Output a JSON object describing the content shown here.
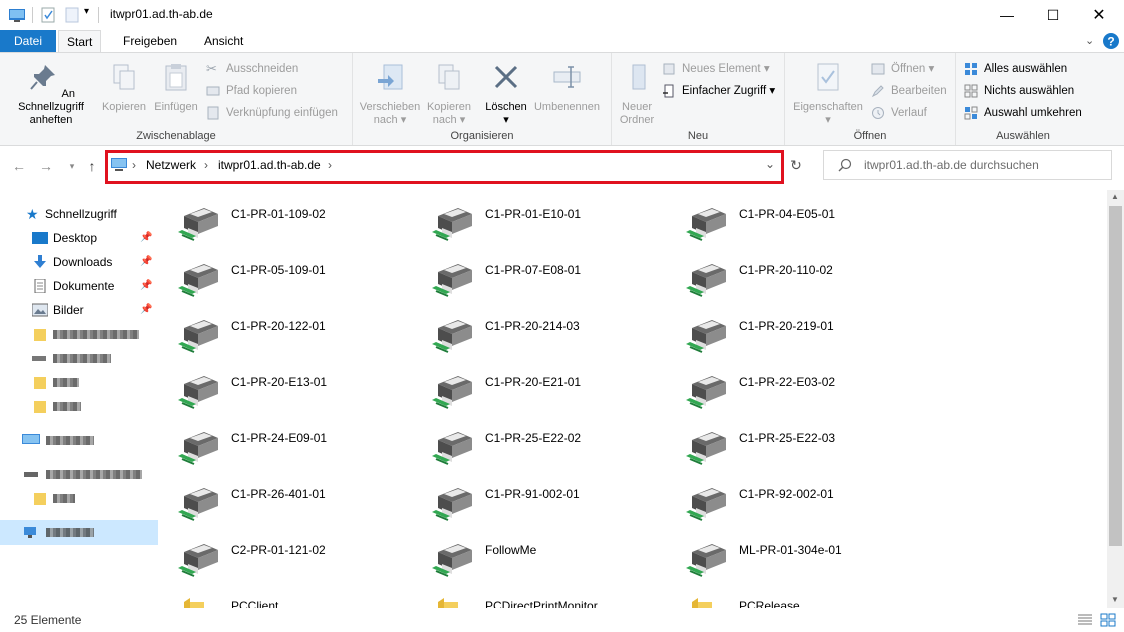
{
  "window": {
    "title": "itwpr01.ad.th-ab.de"
  },
  "ribbon_tabs": [
    "Datei",
    "Start",
    "Freigeben",
    "Ansicht"
  ],
  "ribbon": {
    "clipboard": {
      "pin_quick_access": "An Schnellzugriff anheften",
      "copy": "Kopieren",
      "paste": "Einfügen",
      "cut": "Ausschneiden",
      "copy_path": "Pfad kopieren",
      "paste_shortcut": "Verknüpfung einfügen",
      "group_label": "Zwischenablage"
    },
    "organize": {
      "move_to": "Verschieben nach",
      "copy_to": "Kopieren nach",
      "delete": "Löschen",
      "rename": "Umbenennen",
      "group_label": "Organisieren"
    },
    "new": {
      "new_folder": "Neuer Ordner",
      "new_item": "Neues Element",
      "easy_access": "Einfacher Zugriff",
      "group_label": "Neu"
    },
    "open": {
      "properties": "Eigenschaften",
      "open": "Öffnen",
      "edit": "Bearbeiten",
      "history": "Verlauf",
      "group_label": "Öffnen"
    },
    "select": {
      "select_all": "Alles auswählen",
      "select_none": "Nichts auswählen",
      "invert": "Auswahl umkehren",
      "group_label": "Auswählen"
    }
  },
  "address_bar": {
    "crumbs": [
      "Netzwerk",
      "itwpr01.ad.th-ab.de"
    ]
  },
  "search": {
    "placeholder": "itwpr01.ad.th-ab.de durchsuchen"
  },
  "sidebar": {
    "quick_access": "Schnellzugriff",
    "items": [
      "Desktop",
      "Downloads",
      "Dokumente",
      "Bilder"
    ]
  },
  "files": {
    "printers": [
      "C1-PR-01-109-02",
      "C1-PR-01-E10-01",
      "C1-PR-04-E05-01",
      "C1-PR-05-109-01",
      "C1-PR-07-E08-01",
      "C1-PR-20-110-02",
      "C1-PR-20-122-01",
      "C1-PR-20-214-03",
      "C1-PR-20-219-01",
      "C1-PR-20-E13-01",
      "C1-PR-20-E21-01",
      "C1-PR-22-E03-02",
      "C1-PR-24-E09-01",
      "C1-PR-25-E22-02",
      "C1-PR-25-E22-03",
      "C1-PR-26-401-01",
      "C1-PR-91-002-01",
      "C1-PR-92-002-01",
      "C2-PR-01-121-02",
      "FollowMe",
      "ML-PR-01-304e-01"
    ],
    "folders": [
      "PCClient",
      "PCDirectPrintMonitor",
      "PCRelease"
    ]
  },
  "status": {
    "count": "25 Elemente"
  },
  "colors": {
    "accent": "#1979ca",
    "highlight_border": "#e0111f"
  }
}
